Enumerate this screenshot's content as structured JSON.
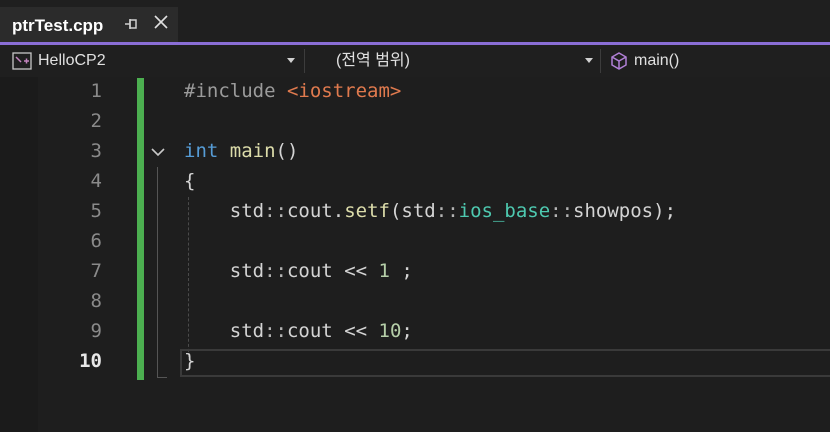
{
  "tab": {
    "title": "ptrTest.cpp",
    "pin_icon": "pin-icon",
    "close_icon": "close-icon"
  },
  "accent_color": "#8a6ed6",
  "navbar": {
    "project": "HelloCP2",
    "scope": "(전역 범위)",
    "member": "main()"
  },
  "editor": {
    "line_numbers": [
      "1",
      "2",
      "3",
      "4",
      "5",
      "6",
      "7",
      "8",
      "9",
      "10"
    ],
    "current_line": "10",
    "code": {
      "l1": {
        "directive": "#include",
        "header": "<iostream>"
      },
      "l3": {
        "keyword": "int",
        "func": "main",
        "parens": "()"
      },
      "l4": {
        "brace": "{"
      },
      "l5": {
        "a": "std",
        "b": "::",
        "c": "cout",
        "d": ".",
        "e": "setf",
        "f": "(",
        "g": "std",
        "h": "::",
        "i": "ios_base",
        "j": "::",
        "k": "showpos",
        "l": ");"
      },
      "l7": {
        "a": "std",
        "b": "::",
        "c": "cout",
        "d": " << ",
        "e": "1",
        "f": " ;"
      },
      "l9": {
        "a": "std",
        "b": "::",
        "c": "cout",
        "d": " << ",
        "e": "10",
        "f": ";"
      },
      "l10": {
        "brace": "}"
      }
    }
  }
}
